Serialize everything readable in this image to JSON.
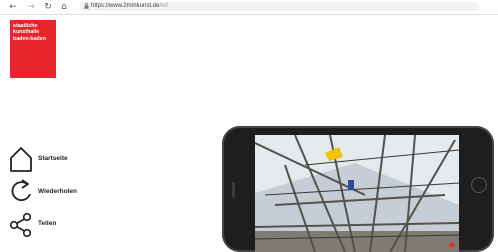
{
  "browser": {
    "back_icon": "arrow-left-icon",
    "forward_icon": "arrow-right-icon",
    "reload_icon": "reload-icon",
    "home_icon": "home-icon",
    "url_host": "https://www.2mmkunst.de",
    "url_path": "/ed"
  },
  "logo": {
    "line1": "staatliche",
    "line2": "kunsthalle",
    "line3": "baden-baden",
    "color": "#e8242c"
  },
  "menu": {
    "items": [
      {
        "label": "Startseite",
        "icon": "house-icon"
      },
      {
        "label": "Wiederholen",
        "icon": "repeat-arrow-icon"
      },
      {
        "label": "Teilen",
        "icon": "share-icon"
      }
    ]
  },
  "phone": {
    "video_subject": "attic-roof-structure"
  }
}
